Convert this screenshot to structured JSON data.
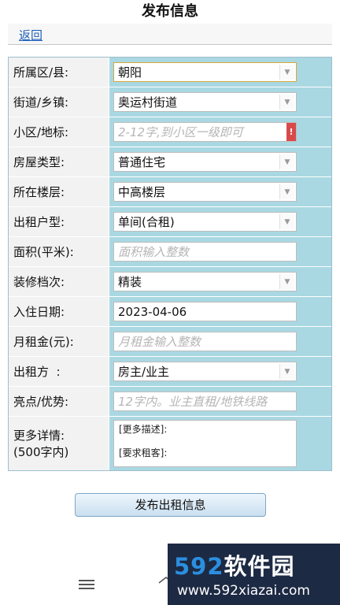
{
  "header": {
    "title": "发布信息",
    "back_label": "返回"
  },
  "form": {
    "district": {
      "label": "所属区/县:",
      "value": "朝阳"
    },
    "street": {
      "label": "街道/乡镇:",
      "value": "奥运村街道"
    },
    "community": {
      "label": "小区/地标:",
      "placeholder": "2-12字,到小区一级即可",
      "required_mark": "!"
    },
    "house_type": {
      "label": "房屋类型:",
      "value": "普通住宅"
    },
    "floor": {
      "label": "所在楼层:",
      "value": "中高楼层"
    },
    "rent_type": {
      "label": "出租户型:",
      "value": "单间(合租)"
    },
    "area": {
      "label": "面积(平米):",
      "placeholder": "面积输入整数"
    },
    "decoration": {
      "label": "装修档次:",
      "value": "精装"
    },
    "move_in_date": {
      "label": "入住日期:",
      "value": "2023-04-06"
    },
    "rent": {
      "label": "月租金(元):",
      "placeholder": "月租金输入整数"
    },
    "landlord": {
      "label": "出租方  :",
      "value": "房主/业主"
    },
    "highlights": {
      "label": "亮点/优势:",
      "placeholder": "12字内。业主直租/地铁线路"
    },
    "details": {
      "label_line1": "更多详情:",
      "label_line2": "(500字内)",
      "line1": "[更多描述]:",
      "line2": "[要求租客]:"
    }
  },
  "submit_label": "发布出租信息",
  "watermark": {
    "num": "592",
    "cn": "软件园",
    "url": "www.592xiazai.com"
  }
}
